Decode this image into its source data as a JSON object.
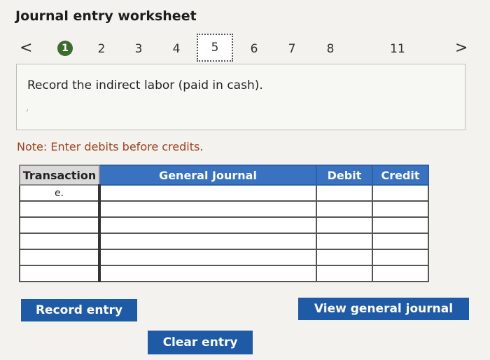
{
  "header": {
    "title": "Journal entry worksheet"
  },
  "nav": {
    "prev": "<",
    "next": ">",
    "steps": [
      "1",
      "2",
      "3",
      "4",
      "5",
      "6",
      "7",
      "8",
      "11"
    ]
  },
  "prompt": {
    "text": "Record the indirect labor (paid in cash)."
  },
  "note": {
    "text": "Note: Enter debits before credits."
  },
  "table": {
    "headers": {
      "transaction": "Transaction",
      "journal": "General Journal",
      "debit": "Debit",
      "credit": "Credit"
    },
    "rows": [
      {
        "transaction": "e.",
        "journal": "",
        "debit": "",
        "credit": ""
      },
      {
        "transaction": "",
        "journal": "",
        "debit": "",
        "credit": ""
      },
      {
        "transaction": "",
        "journal": "",
        "debit": "",
        "credit": ""
      },
      {
        "transaction": "",
        "journal": "",
        "debit": "",
        "credit": ""
      },
      {
        "transaction": "",
        "journal": "",
        "debit": "",
        "credit": ""
      },
      {
        "transaction": "",
        "journal": "",
        "debit": "",
        "credit": ""
      }
    ]
  },
  "buttons": {
    "record": "Record entry",
    "view": "View general journal",
    "clear": "Clear entry"
  },
  "colors": {
    "button": "#1f5aa6",
    "header": "#3972c0",
    "note": "#a0421e",
    "done_step": "#3b6b2f"
  }
}
